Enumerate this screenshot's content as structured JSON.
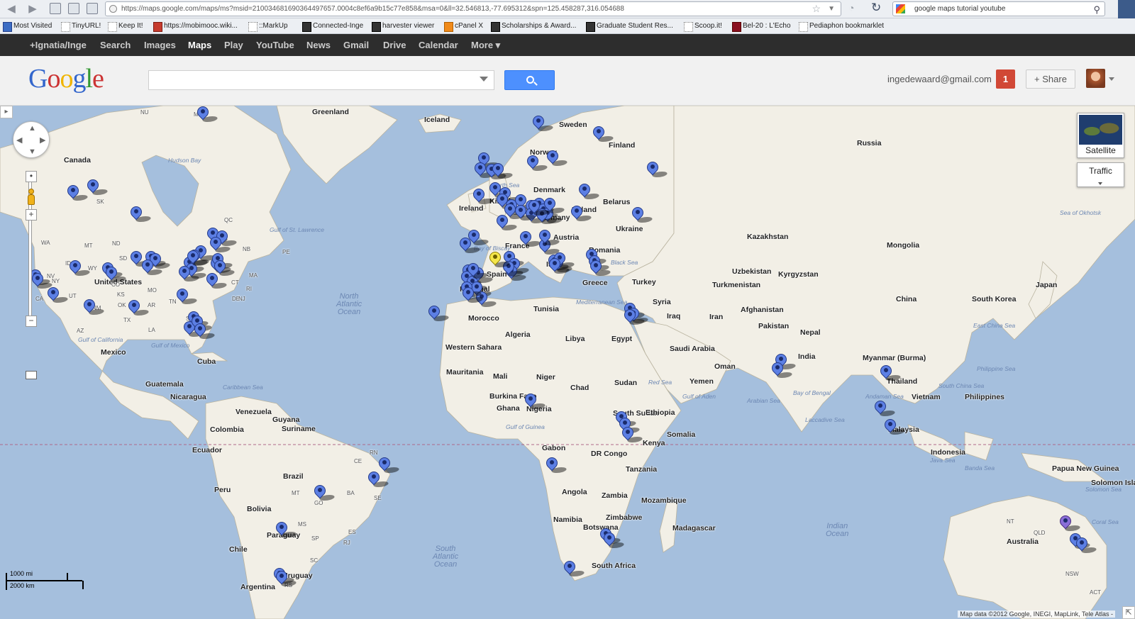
{
  "browser": {
    "url": "https://maps.google.com/maps/ms?msid=210034681690364497657.0004c8ef6a9b15c77e858&msa=0&ll=32.546813,-77.695312&spn=125.458287,316.054688",
    "search_value": "google maps tutorial youtube"
  },
  "bookmarks": [
    "Most Visited",
    "TinyURL!",
    "Keep It!",
    "https://mobimooc.wiki...",
    "::MarkUp",
    "Connected-Inge",
    "harvester viewer",
    "cPanel X",
    "Scholarships & Award...",
    "Graduate Student Res...",
    "Scoop.it!",
    "Bel-20 : L'Echo",
    "Pediaphon bookmarklet"
  ],
  "gbar": [
    "+Ignatia/Inge",
    "Search",
    "Images",
    "Maps",
    "Play",
    "YouTube",
    "News",
    "Gmail",
    "Drive",
    "Calendar",
    "More ▾"
  ],
  "header": {
    "logo_letters": [
      "G",
      "o",
      "o",
      "g",
      "l",
      "e"
    ],
    "logo_colors": [
      "#3366cc",
      "#cc3333",
      "#f0b400",
      "#3366cc",
      "#339933",
      "#cc3333"
    ],
    "email": "ingedewaard@gmail.com",
    "notifications": "1",
    "share_label": "+ Share",
    "search_value": ""
  },
  "map_controls": {
    "satellite_label": "Satellite",
    "traffic_label": "Traffic",
    "scale_top": "1000 mi",
    "scale_bottom": "2000 km",
    "attribution": "Map data ©2012 Google, INEGI, MapLink, Tele Atlas -"
  },
  "labels": {
    "countries": [
      "Greenland",
      "Iceland",
      "Sweden",
      "Finland",
      "Norway",
      "Russia",
      "Canada",
      "United States",
      "Mexico",
      "Cuba",
      "Guatemala",
      "Nicaragua",
      "Venezuela",
      "Guyana",
      "Suriname",
      "Colombia",
      "Ecuador",
      "Peru",
      "Brazil",
      "Bolivia",
      "Paraguay",
      "Chile",
      "Argentina",
      "Uruguay",
      "Ireland",
      "Kingdom",
      "Denmark",
      "Germany",
      "Poland",
      "Belarus",
      "Ukraine",
      "France",
      "Austria",
      "Romania",
      "Spain",
      "Portugal",
      "Italy",
      "Greece",
      "Turkey",
      "Tunisia",
      "Morocco",
      "Algeria",
      "Libya",
      "Egypt",
      "Western Sahara",
      "Mauritania",
      "Mali",
      "Niger",
      "Chad",
      "Sudan",
      "Burkina Faso",
      "Ghana",
      "Nigeria",
      "South Sudan",
      "Ethiopia",
      "Somalia",
      "Kenya",
      "Gabon",
      "DR Congo",
      "Tanzania",
      "Angola",
      "Zambia",
      "Mozambique",
      "Namibia",
      "Zimbabwe",
      "Botswana",
      "South Africa",
      "Madagascar",
      "Syria",
      "Iraq",
      "Iran",
      "Saudi Arabia",
      "Oman",
      "Yemen",
      "Kazakhstan",
      "Uzbekistan",
      "Kyrgyzstan",
      "Turkmenistan",
      "Afghanistan",
      "Pakistan",
      "Nepal",
      "India",
      "Mongolia",
      "China",
      "South Korea",
      "Japan",
      "Myanmar (Burma)",
      "Thailand",
      "Vietnam",
      "Philippines",
      "Malaysia",
      "Indonesia",
      "Papua New Guinea",
      "Solomon Islands",
      "Australia"
    ],
    "states": [
      "NU",
      "MB",
      "SK",
      "QC",
      "WA",
      "MT",
      "ND",
      "SD",
      "ID",
      "WY",
      "NV",
      "CA",
      "UT",
      "CO",
      "KS",
      "MO",
      "OK",
      "AR",
      "TX",
      "LA",
      "TN",
      "NY",
      "PE",
      "MA",
      "CT",
      "RI",
      "DE",
      "NJ",
      "SC",
      "NB",
      "NM",
      "AZ",
      "RN",
      "CE",
      "SE",
      "BA",
      "GO",
      "MT",
      "MS",
      "SP",
      "RJ",
      "ES",
      "SC",
      "RS",
      "QLD",
      "NSW",
      "ACT",
      "NT"
    ],
    "oceans": [
      "North Atlantic Ocean",
      "South Atlantic Ocean",
      "Indian Ocean"
    ],
    "seas": [
      "Hudson Bay",
      "Gulf of St. Lawrence",
      "Gulf of Mexico",
      "Gulf of California",
      "Caribbean Sea",
      "North Sea",
      "Bay of Biscay",
      "Mediterranean Sea",
      "Black Sea",
      "Red Sea",
      "Gulf of Aden",
      "Arabian Sea",
      "Bay of Bengal",
      "Andaman Sea",
      "South China Sea",
      "Philippine Sea",
      "East China Sea",
      "Java Sea",
      "Banda Sea",
      "Coral Sea",
      "Solomon Sea",
      "Laccadive Sea",
      "Gulf of Guinea",
      "Sea of Okhotsk"
    ]
  },
  "markers": {
    "blue_count": 113,
    "yellow_count": 1,
    "purple_count": 1
  }
}
